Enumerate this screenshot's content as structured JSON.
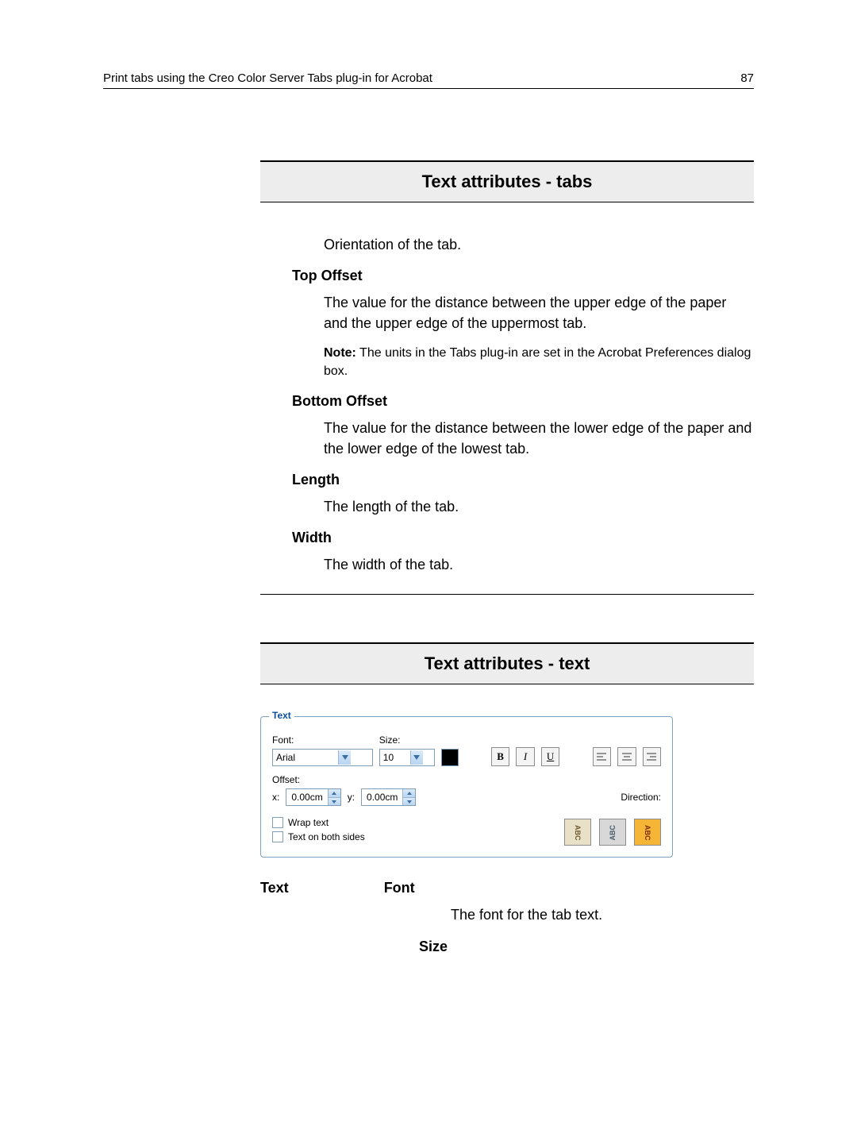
{
  "header": {
    "title": "Print tabs using the Creo Color Server Tabs plug-in for Acrobat",
    "page_number": "87"
  },
  "sections": {
    "tabs": {
      "title": "Text attributes - tabs",
      "orientation": "Orientation of the tab.",
      "top_offset": {
        "term": "Top Offset",
        "def": "The value for the distance between the upper edge of the paper and the upper edge of the uppermost tab.",
        "note_label": "Note:",
        "note": " The units in the Tabs plug-in are set in the Acrobat Preferences dialog box."
      },
      "bottom_offset": {
        "term": "Bottom Offset",
        "def": "The value for the distance between the lower edge of the paper and the lower edge of the lowest tab."
      },
      "length": {
        "term": "Length",
        "def": "The length of the tab."
      },
      "width": {
        "term": "Width",
        "def": "The width of the tab."
      }
    },
    "text": {
      "title": "Text attributes - text",
      "panel": {
        "legend": "Text",
        "font_label": "Font:",
        "font_value": "Arial",
        "size_label": "Size:",
        "size_value": "10",
        "offset_label": "Offset:",
        "x_label": "x:",
        "x_value": "0.00cm",
        "y_label": "y:",
        "y_value": "0.00cm",
        "wrap_text": "Wrap text",
        "both_sides": "Text on both sides",
        "direction_label": "Direction:",
        "bold": "B",
        "italic": "I",
        "underline": "U",
        "dir1": "ABC",
        "dir2": "ABC",
        "dir3": "ABC"
      },
      "left_heading": "Text",
      "font": {
        "term": "Font",
        "def": "The font for the tab text."
      },
      "size": {
        "term": "Size"
      }
    }
  }
}
